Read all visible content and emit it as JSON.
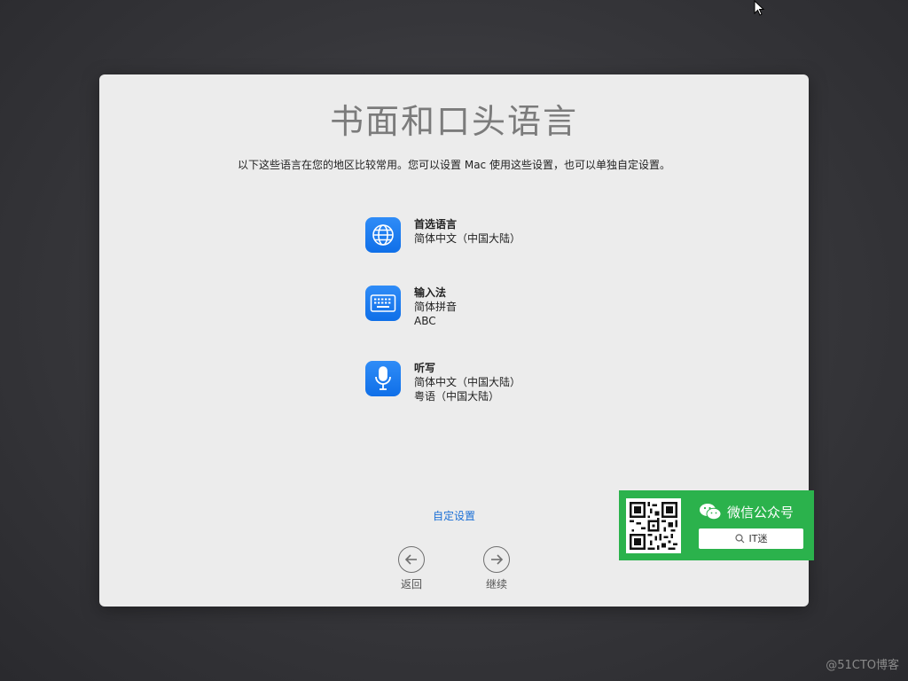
{
  "page": {
    "title": "书面和口头语言",
    "subtitle": "以下这些语言在您的地区比较常用。您可以设置 Mac 使用这些设置，也可以单独自定设置。"
  },
  "settings": [
    {
      "icon": "globe-icon",
      "heading": "首选语言",
      "values": [
        "简体中文（中国大陆）"
      ]
    },
    {
      "icon": "keyboard-icon",
      "heading": "输入法",
      "values": [
        "简体拼音",
        "ABC"
      ]
    },
    {
      "icon": "microphone-icon",
      "heading": "听写",
      "values": [
        "简体中文（中国大陆）",
        "粤语（中国大陆）"
      ]
    }
  ],
  "customize_link": "自定设置",
  "nav": {
    "back_label": "返回",
    "next_label": "继续"
  },
  "wechat_overlay": {
    "title": "微信公众号",
    "search_text": "IT迷"
  },
  "watermark": "@51CTO博客",
  "colors": {
    "accent": "#0f6fe8",
    "link": "#1a6fd6",
    "wechat_green": "#2bb24c"
  }
}
